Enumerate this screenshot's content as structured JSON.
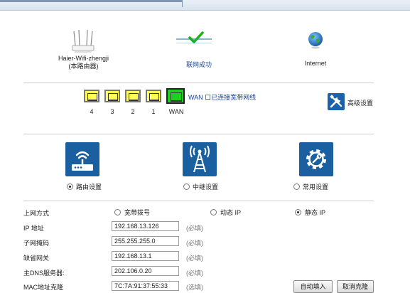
{
  "status": {
    "router_name": "Haier-Wifi-zhengji",
    "router_sub": "(本路由器)",
    "connection_label": "联网成功",
    "internet_label": "Internet"
  },
  "ports": {
    "labels": [
      "4",
      "3",
      "2",
      "1",
      "WAN"
    ],
    "wan_note": "WAN 口已连接宽带网线",
    "advanced_label": "高级设置"
  },
  "modes": {
    "items": [
      {
        "label": "路由设置",
        "selected": true
      },
      {
        "label": "中继设置",
        "selected": false
      },
      {
        "label": "常用设置",
        "selected": false
      }
    ]
  },
  "form": {
    "conn_type_label": "上网方式",
    "conn_options": [
      {
        "label": "宽带拨号",
        "selected": false
      },
      {
        "label": "动态 IP",
        "selected": false
      },
      {
        "label": "静态 IP",
        "selected": true
      }
    ],
    "fields": [
      {
        "label": "IP 地址",
        "value": "192.168.13.126",
        "note": "(必填)"
      },
      {
        "label": "子网掩码",
        "value": "255.255.255.0",
        "note": "(必填)"
      },
      {
        "label": "缺省网关",
        "value": "192.168.13.1",
        "note": "(必填)"
      },
      {
        "label": "主DNS服务器:",
        "value": "202.106.0.20",
        "note": "(必填)"
      },
      {
        "label": "MAC地址克隆",
        "value": "7C:7A:91:37:55:33",
        "note": "(选填)"
      }
    ],
    "button_auto_detect": "自动填入",
    "button_cancel": "取消克隆"
  },
  "colors": {
    "port_lan": "#ffff55",
    "port_wan": "#1ed01e",
    "icon_blue": "#1a5fa0",
    "link_text": "#1a3f9a"
  }
}
